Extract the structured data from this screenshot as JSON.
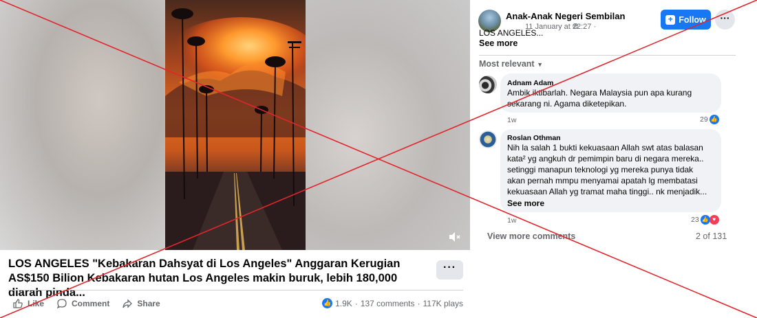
{
  "video": {
    "volume_icon": "speaker-muted-icon"
  },
  "post": {
    "title": "LOS ANGELES \"Kebakaran Dahsyat di Los Angeles\" Anggaran Kerugian AS$150 Bilion Kebakaran hutan Los Angeles makin buruk, lebih 180,000 diarah pinda...",
    "more_label": "···",
    "actions": {
      "like": "Like",
      "comment": "Comment",
      "share": "Share"
    },
    "stats": {
      "reactions": "1.9K",
      "comments": "137 comments",
      "plays": "117K plays",
      "separator": "·"
    }
  },
  "page": {
    "name": "Anak-Anak Negeri Sembilan",
    "time": "11 January at 22:27 ·",
    "text": "LOS ANGELES...",
    "see_more": "See more",
    "follow_label": "Follow",
    "options_label": "···"
  },
  "comments": {
    "sort_label": "Most relevant",
    "items": [
      {
        "name": "Adnam Adam",
        "lines": [
          "Ambik iktibarlah. Negara Malaysia pun apa kurang",
          "sekarang ni. Agama diketepikan."
        ],
        "age": "1w",
        "reactions": "29"
      },
      {
        "name": "Roslan Othman",
        "lines": [
          "Nih la salah 1 bukti kekuasaan Allah swt atas balasan",
          "kata² yg angkuh dr pemimpin baru di negara mereka..",
          "setinggi manapun teknologi yg mereka punya tidak",
          "akan pernah mmpu menyamai apatah lg membatasi",
          "kekuasaan Allah yg tramat maha tinggi.. nk menjadik..."
        ],
        "see_more": "See more",
        "age": "1w",
        "reactions": "23"
      }
    ],
    "view_more": "View more comments",
    "count": "2 of 131"
  },
  "colors": {
    "accent": "#1877f2",
    "cross": "#e0262c",
    "muted_text": "#65676b"
  }
}
